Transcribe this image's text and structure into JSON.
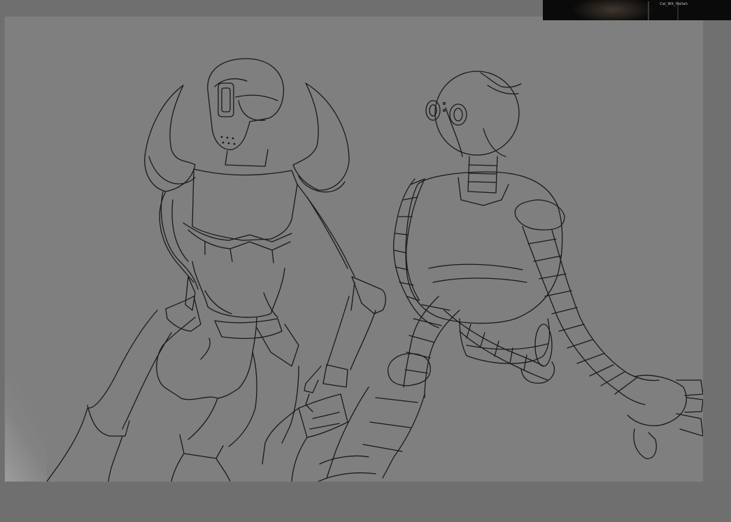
{
  "preview": {
    "caption": "Cal_Wit_Hallah"
  },
  "colors": {
    "workspace": "#6f6f6f",
    "canvas": "#7f7f7f",
    "stroke": "#1a1a1a"
  }
}
